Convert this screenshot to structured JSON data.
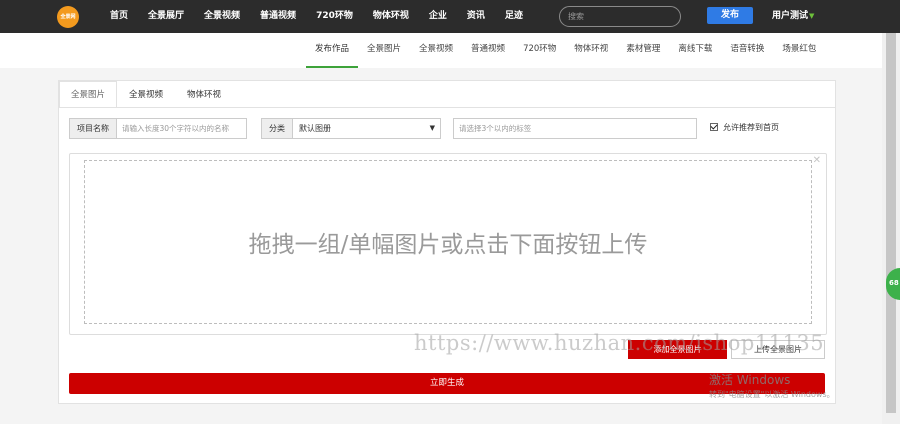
{
  "header": {
    "logo_text": "全景网",
    "nav": [
      "首页",
      "全景展厅",
      "全景视频",
      "普通视频",
      "720环物",
      "物体环视",
      "企业",
      "资讯",
      "足迹"
    ],
    "search_placeholder": "搜索",
    "publish_label": "发布",
    "user_label": "用户测试"
  },
  "subnav": {
    "items": [
      "发布作品",
      "全景图片",
      "全景视频",
      "普通视频",
      "720环物",
      "物体环视",
      "素材管理",
      "离线下载",
      "语音转换",
      "场景红包"
    ],
    "active_index": 0
  },
  "panel": {
    "tabs": [
      "全景图片",
      "全景视频",
      "物体环视"
    ],
    "active_tab": 0,
    "project_name_label": "项目名称",
    "project_name_placeholder": "请输入长度30个字符以内的名称",
    "category_label": "分类",
    "category_value": "默认图册",
    "tags_placeholder": "请选择3个以内的标签",
    "recommend_label": "允许推荐到首页",
    "recommend_checked": true,
    "drop_text": "拖拽一组/单幅图片或点击下面按钮上传",
    "add_button": "添加全景图片",
    "upload_button": "上传全景图片",
    "generate_button": "立即生成"
  },
  "overlays": {
    "side_badge": "68",
    "watermark": "https://www.huzhan.com/ishop11135",
    "activate_title": "激活 Windows",
    "activate_sub": "转到\"电脑设置\"以激活 Windows。"
  },
  "colors": {
    "topbar": "#2c2c2c",
    "accent_red": "#cc0000",
    "publish_blue": "#2f7be5",
    "active_green": "#3da33a"
  }
}
